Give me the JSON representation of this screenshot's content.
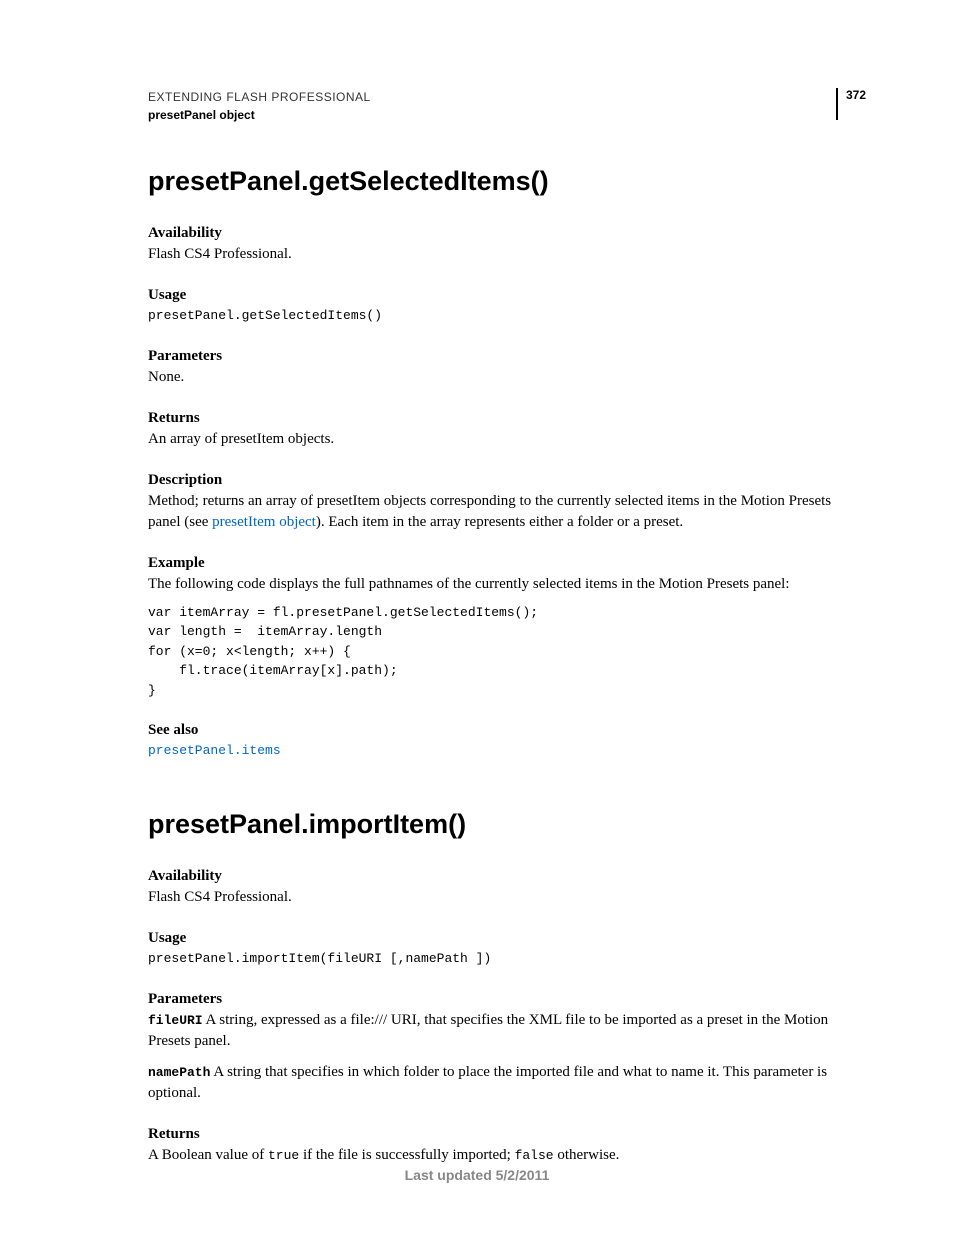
{
  "header": {
    "breadcrumb": "EXTENDING FLASH PROFESSIONAL",
    "title": "presetPanel object",
    "page_number": "372"
  },
  "section1": {
    "heading": "presetPanel.getSelectedItems()",
    "availability_label": "Availability",
    "availability_text": "Flash CS4 Professional.",
    "usage_label": "Usage",
    "usage_code": "presetPanel.getSelectedItems()",
    "parameters_label": "Parameters",
    "parameters_text": "None.",
    "returns_label": "Returns",
    "returns_text": "An array of presetItem objects.",
    "description_label": "Description",
    "description_pre": "Method; returns an array of presetItem objects corresponding to the currently selected items in the Motion Presets panel (see ",
    "description_link": "presetItem object",
    "description_post": "). Each item in the array represents either a folder or a preset.",
    "example_label": "Example",
    "example_intro": "The following code displays the full pathnames of the currently selected items in the Motion Presets panel:",
    "example_code": "var itemArray = fl.presetPanel.getSelectedItems(); \nvar length =  itemArray.length \nfor (x=0; x<length; x++) { \n    fl.trace(itemArray[x].path); \n}",
    "seealso_label": "See also",
    "seealso_link": "presetPanel.items"
  },
  "section2": {
    "heading": "presetPanel.importItem()",
    "availability_label": "Availability",
    "availability_text": "Flash CS4 Professional.",
    "usage_label": "Usage",
    "usage_code": "presetPanel.importItem(fileURI [,namePath ])",
    "parameters_label": "Parameters",
    "param1_name": "fileURI",
    "param1_text": "  A string, expressed as a file:/// URI, that specifies the XML file to be imported as a preset in the Motion Presets panel.",
    "param2_name": "namePath",
    "param2_text": "  A string that specifies in which folder to place the imported file and what to name it. This parameter is optional.",
    "returns_label": "Returns",
    "returns_pre": "A Boolean value of ",
    "returns_true": "true",
    "returns_mid": " if the file is successfully imported; ",
    "returns_false": "false",
    "returns_post": " otherwise."
  },
  "footer": {
    "last_updated": "Last updated 5/2/2011"
  }
}
